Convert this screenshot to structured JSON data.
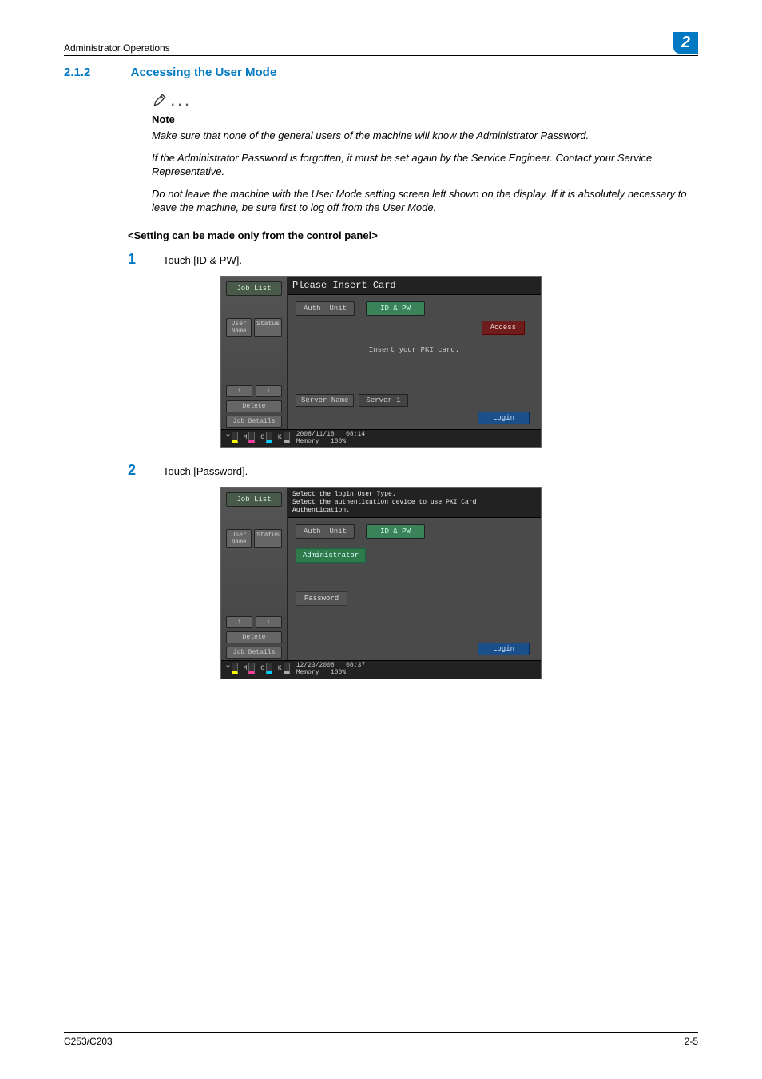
{
  "header": {
    "title": "Administrator Operations",
    "chapter": "2"
  },
  "section": {
    "number": "2.1.2",
    "title": "Accessing the User Mode"
  },
  "note": {
    "dots": ". . .",
    "label": "Note",
    "p1": "Make sure that none of the general users of the machine will know the Administrator Password.",
    "p2": "If the Administrator Password is forgotten, it must be set again by the Service Engineer. Contact your Service Representative.",
    "p3": "Do not leave the machine with the User Mode setting screen left shown on the display. If it is absolutely necessary to leave the machine, be sure first to log off from the User Mode."
  },
  "subset_heading": "<Setting can be made only from the control panel>",
  "steps": {
    "s1num": "1",
    "s1text": "Touch [ID & PW].",
    "s2num": "2",
    "s2text": "Touch [Password]."
  },
  "panel1": {
    "job_list": "Job List",
    "user_name_label": "User Name",
    "status": "Status",
    "up": "↑",
    "down": "↓",
    "delete": "Delete",
    "job_details": "Job Details",
    "title": "Please Insert Card",
    "tab_auth": "Auth. Unit",
    "tab_idpw": "ID & PW",
    "access": "Access",
    "center": "Insert your PKI card.",
    "server_name": "Server Name",
    "server_val": "Server 1",
    "login": "Login",
    "date": "2008/11/18",
    "time": "08:14",
    "memory": "Memory",
    "mempct": "100%",
    "ink_y": "Y",
    "ink_m": "M",
    "ink_c": "C",
    "ink_k": "K"
  },
  "panel2": {
    "job_list": "Job List",
    "user_name_label": "User Name",
    "status": "Status",
    "up": "↑",
    "down": "↓",
    "delete": "Delete",
    "job_details": "Job Details",
    "title_l1": "Select the login User Type.",
    "title_l2": "Select the authentication device to use PKI Card Authentication.",
    "tab_auth": "Auth. Unit",
    "tab_idpw": "ID & PW",
    "administrator": "Administrator",
    "password": "Password",
    "login": "Login",
    "date": "12/23/2008",
    "time": "08:37",
    "memory": "Memory",
    "mempct": "100%",
    "ink_y": "Y",
    "ink_m": "M",
    "ink_c": "C",
    "ink_k": "K"
  },
  "footer": {
    "model": "C253/C203",
    "page": "2-5"
  }
}
